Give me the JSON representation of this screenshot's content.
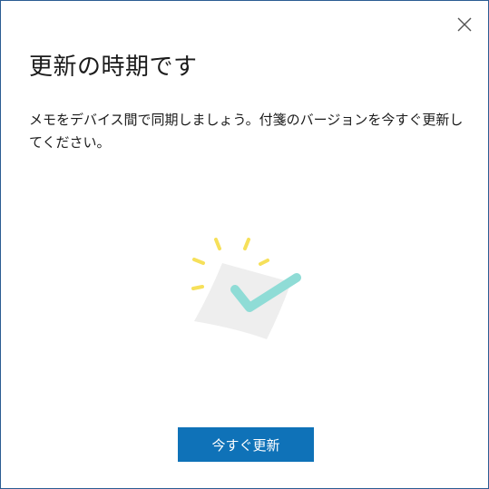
{
  "dialog": {
    "title": "更新の時期です",
    "message": "メモをデバイス間で同期しましょう。付箋のバージョンを今すぐ更新してください。",
    "close_icon": "close-icon",
    "illustration_icon": "sticky-note-checkmark-icon",
    "primary_button_label": "今すぐ更新"
  },
  "colors": {
    "border": "#2b5c93",
    "button_bg": "#0f72b8",
    "check": "#8fdcd6",
    "sparkle": "#f6e05a",
    "note": "#eeeeee"
  }
}
